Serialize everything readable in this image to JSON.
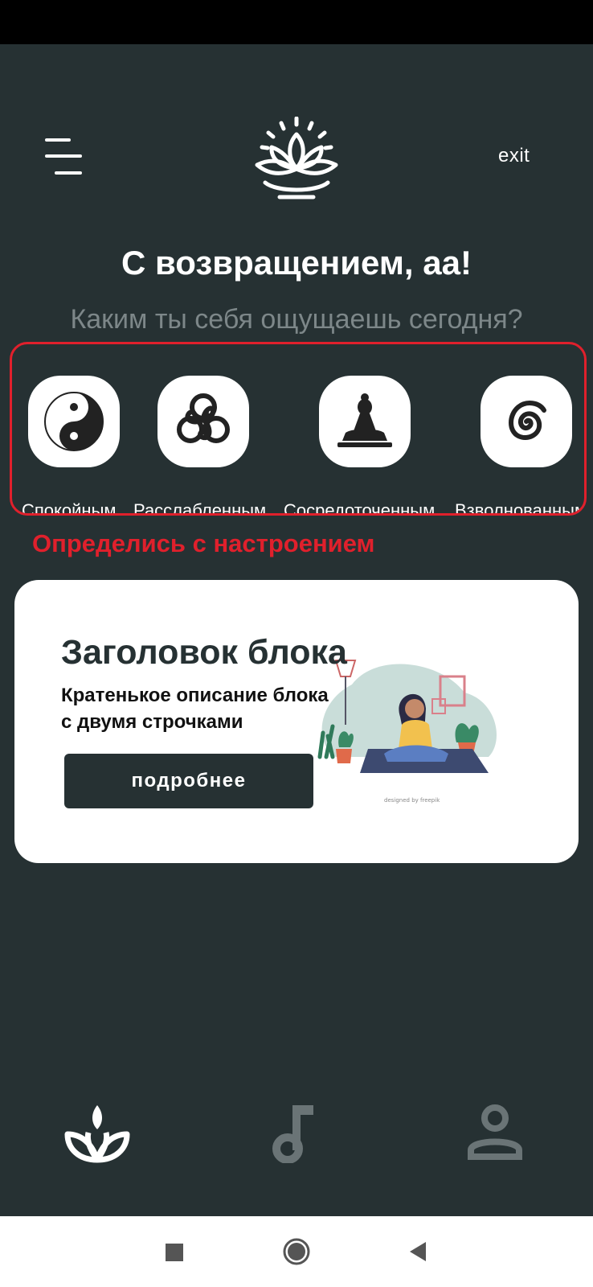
{
  "header": {
    "menu_icon": "hamburger-menu-icon",
    "logo_icon": "lotus-logo-icon",
    "exit_label": "exit"
  },
  "greeting": "С возвращением, аа!",
  "question": "Каким ты себя ощущаешь сегодня?",
  "moods": [
    {
      "label": "Спокойным",
      "icon": "yin-yang-icon"
    },
    {
      "label": "Расслабленным",
      "icon": "triskelion-icon"
    },
    {
      "label": "Сосредоточенным",
      "icon": "meditating-buddha-icon"
    },
    {
      "label": "Взволнованным",
      "icon": "spiral-icon"
    }
  ],
  "annotation": "Определись с настроением",
  "card": {
    "title": "Заголовок блока",
    "description": "Кратенькое описание блока\nс двумя строчками",
    "button_label": "подробнее",
    "illustration": "woman-meditating-illustration"
  },
  "bottom_tabs": [
    {
      "icon": "lotus-tab-icon",
      "active": true
    },
    {
      "icon": "music-note-icon",
      "active": false
    },
    {
      "icon": "profile-icon",
      "active": false
    }
  ],
  "system_nav": [
    "recent-apps-icon",
    "home-icon",
    "back-icon"
  ],
  "colors": {
    "background": "#263133",
    "accent_red": "#e0202c",
    "card": "#ffffff",
    "inactive_icon": "#6a7476"
  }
}
